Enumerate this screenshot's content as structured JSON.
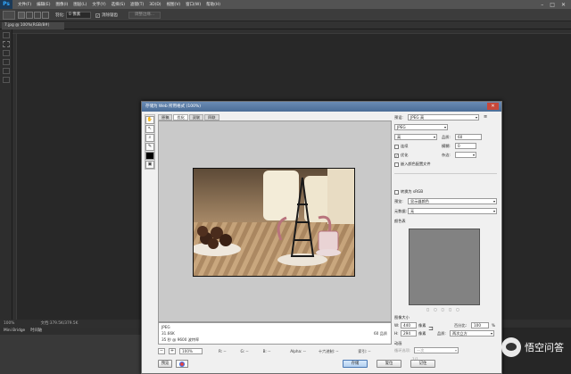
{
  "app": {
    "logo": "Ps",
    "menu": [
      "文件(F)",
      "编辑(E)",
      "图像(I)",
      "图层(L)",
      "文字(Y)",
      "选择(S)",
      "滤镜(T)",
      "3D(D)",
      "视图(V)",
      "窗口(W)",
      "帮助(H)"
    ],
    "window_controls": [
      "–",
      "□",
      "✕"
    ]
  },
  "options_bar": {
    "style_label": "羽化:",
    "style_value": "0 像素",
    "antialias": "消除锯齿",
    "refine_button": "调整边缘..."
  },
  "document": {
    "tab_label": "7.jpg @ 100%(RGB/8#)"
  },
  "status": {
    "zoom": "100%",
    "doc": "文档:379.5K/379.5K"
  },
  "bottom_panel": {
    "tabs": [
      "Mini Bridge",
      "时间轴"
    ]
  },
  "dialog": {
    "title": "存储为 Web 所用格式 (100%)",
    "close": "✕",
    "view_tabs": [
      "原稿",
      "优化",
      "双联",
      "四联"
    ],
    "info": {
      "format": "JPEG",
      "size": "31.66K",
      "time": "35 秒 @ 9600 波特率",
      "quality": "60 品质"
    },
    "bottom": {
      "zoom": "100%",
      "r": "R: --",
      "g": "G: --",
      "b": "B: --",
      "alpha": "Alpha: --",
      "hex": "十六进制: --",
      "index": "索引: --"
    },
    "footer": {
      "preview_button": "预览",
      "save_button": "存储",
      "reset_button": "复位",
      "remember_button": "记住"
    },
    "settings": {
      "preset_label": "预设:",
      "preset_value": "JPEG 高",
      "format_value": "JPEG",
      "compression_value": "高",
      "quality_label": "品质:",
      "quality_value": "60",
      "progressive": "连续",
      "blur_label": "模糊:",
      "blur_value": "0",
      "optimized": "优化",
      "matte_label": "杂边:",
      "embed_profile": "嵌入颜色配置文件",
      "convert_srgb": "转换为 sRGB",
      "preview_label": "预览:",
      "preview_value": "显示器颜色",
      "metadata_label": "元数据:",
      "metadata_value": "无",
      "color_table_label": "颜色表",
      "image_size_label": "图像大小",
      "w_label": "W:",
      "w_value": "440",
      "h_label": "H:",
      "h_value": "294",
      "px_label": "像素",
      "percent_label": "百分比:",
      "percent_value": "100",
      "percent_unit": "%",
      "quality2_label": "品质:",
      "quality2_value": "两次立方",
      "animation_label": "动画",
      "loop_label": "循环选项:",
      "loop_value": "一次",
      "frame_counter": "1/1"
    }
  },
  "watermark": {
    "text": "悟空问答"
  }
}
